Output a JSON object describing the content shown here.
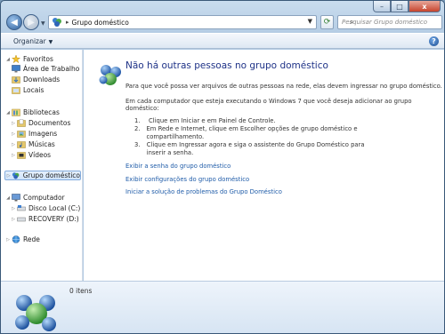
{
  "window": {
    "minimize": "–",
    "maximize": "□",
    "close": "x"
  },
  "address": {
    "location": "Grupo doméstico",
    "separator": "▸",
    "search_placeholder": "Pesquisar Grupo doméstico"
  },
  "toolbar": {
    "organize_label": "Organizar",
    "help_label": "?"
  },
  "sidebar": {
    "favorites": {
      "label": "Favoritos",
      "items": [
        "Área de Trabalho",
        "Downloads",
        "Locais"
      ]
    },
    "libraries": {
      "label": "Bibliotecas",
      "items": [
        "Documentos",
        "Imagens",
        "Músicas",
        "Vídeos"
      ]
    },
    "homegroup": {
      "label": "Grupo doméstico"
    },
    "computer": {
      "label": "Computador",
      "items": [
        "Disco Local (C:)",
        "RECOVERY (D:)"
      ]
    },
    "network": {
      "label": "Rede"
    }
  },
  "main": {
    "heading": "Não há outras pessoas no grupo doméstico",
    "para1": "Para que você possa ver arquivos de outras pessoas na rede, elas devem ingressar no grupo doméstico.",
    "para2": "Em cada computador que esteja executando o Windows 7 que você deseja adicionar ao grupo doméstico:",
    "steps": [
      {
        "num": "1.",
        "text": "Clique em Iniciar e em Painel de Controle."
      },
      {
        "num": "2.",
        "text": "Em Rede e Internet, clique em Escolher opções de grupo doméstico e compartilhamento."
      },
      {
        "num": "3.",
        "text": "Clique em Ingressar agora e siga o assistente do Grupo Doméstico para inserir a senha."
      }
    ],
    "links": [
      "Exibir a senha do grupo doméstico",
      "Exibir configurações do grupo doméstico",
      "Iniciar a solução de problemas do Grupo Doméstico"
    ]
  },
  "details": {
    "count": "0 itens"
  },
  "colors": {
    "link": "#1e5ba8",
    "heading": "#1e3287",
    "selection": "#cfe3fb"
  }
}
